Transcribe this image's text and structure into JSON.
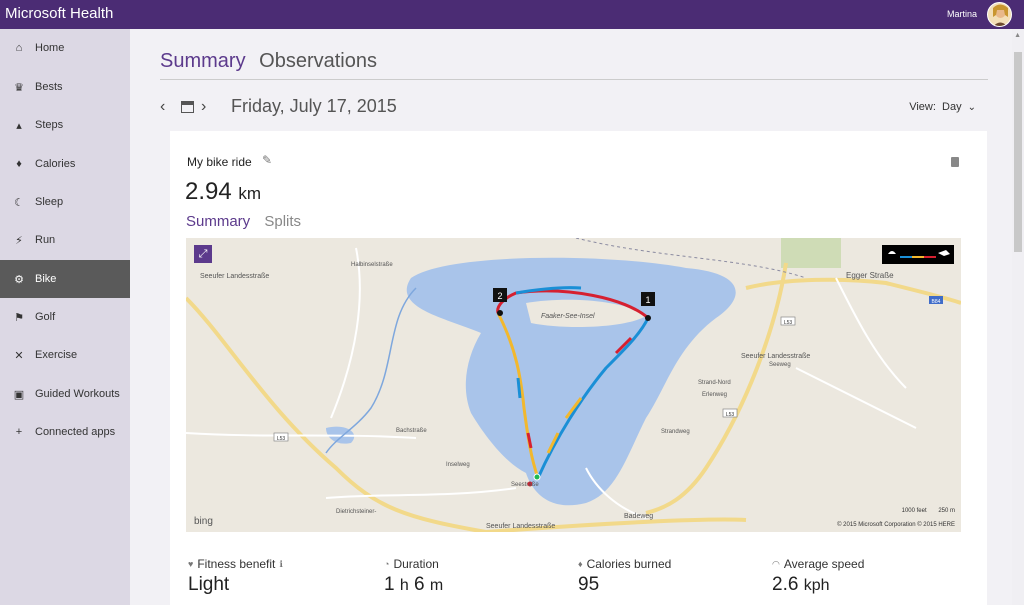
{
  "header": {
    "app_title": "Microsoft Health",
    "user_name": "Martina"
  },
  "sidebar": {
    "items": [
      {
        "label": "Home",
        "icon": "home-icon",
        "glyph": "⌂"
      },
      {
        "label": "Bests",
        "icon": "trophy-icon",
        "glyph": "♛"
      },
      {
        "label": "Steps",
        "icon": "shoe-icon",
        "glyph": "▴"
      },
      {
        "label": "Calories",
        "icon": "flame-icon",
        "glyph": "♦"
      },
      {
        "label": "Sleep",
        "icon": "moon-icon",
        "glyph": "☾"
      },
      {
        "label": "Run",
        "icon": "run-icon",
        "glyph": "⚡"
      },
      {
        "label": "Bike",
        "icon": "bike-icon",
        "glyph": "⚙"
      },
      {
        "label": "Golf",
        "icon": "golf-icon",
        "glyph": "⚑"
      },
      {
        "label": "Exercise",
        "icon": "exercise-icon",
        "glyph": "✕"
      },
      {
        "label": "Guided Workouts",
        "icon": "workout-icon",
        "glyph": "▣"
      },
      {
        "label": "Connected apps",
        "icon": "plus-icon",
        "glyph": "+"
      }
    ]
  },
  "tabs": {
    "summary": "Summary",
    "observations": "Observations"
  },
  "date_nav": {
    "date": "Friday, July 17, 2015",
    "prev": "‹",
    "next": "›"
  },
  "view": {
    "label": "View:",
    "value": "Day",
    "chevron": "⌄"
  },
  "activity": {
    "title": "My bike ride",
    "distance_value": "2.94",
    "distance_unit": "km",
    "tabs": {
      "summary": "Summary",
      "splits": "Splits"
    }
  },
  "map": {
    "labels": {
      "island": "Faaker-See-Insel",
      "egger": "Egger Straße",
      "seeufer_top": "Seeufer Landesstraße",
      "seeufer_right": "Seeufer Landesstraße",
      "seeufer_bottom": "Seeufer Landesstraße",
      "badeweg": "Badeweg",
      "bachstrasse": "Bachstraße",
      "seeweg": "Seeweg",
      "strand_nord": "Strand-Nord",
      "erlenweg": "Erlenweg",
      "strandweg": "Strandweg",
      "dietrichsteiner": "Dietrichsteiner-",
      "inselweg": "Inselweg",
      "seestr": "Seestraße",
      "halbinsel": "Halbinselstraße",
      "l53a": "L53",
      "l53b": "L53",
      "l53c": "L53",
      "b84": "B84"
    },
    "markers": {
      "start": "1",
      "turn": "2"
    },
    "bing": "bing",
    "scale_feet": "1000 feet",
    "scale_m": "250 m",
    "attribution": "© 2015 Microsoft Corporation   © 2015 HERE"
  },
  "stats": [
    {
      "label": "Fitness benefit",
      "value": "Light",
      "icon": "heart-icon",
      "glyph": "♥",
      "unit1": "",
      "value2": "",
      "unit2": ""
    },
    {
      "label": "Duration",
      "value": "1",
      "unit1": "h",
      "value2": "6",
      "unit2": "m",
      "icon": "clock-icon",
      "glyph": "◔"
    },
    {
      "label": "Calories burned",
      "value": "95",
      "icon": "flame-icon",
      "glyph": "♦",
      "unit1": "",
      "value2": "",
      "unit2": ""
    },
    {
      "label": "Average speed",
      "value": "2.6",
      "unit1": "kph",
      "icon": "speedometer-icon",
      "glyph": "◠",
      "value2": "",
      "unit2": ""
    }
  ]
}
